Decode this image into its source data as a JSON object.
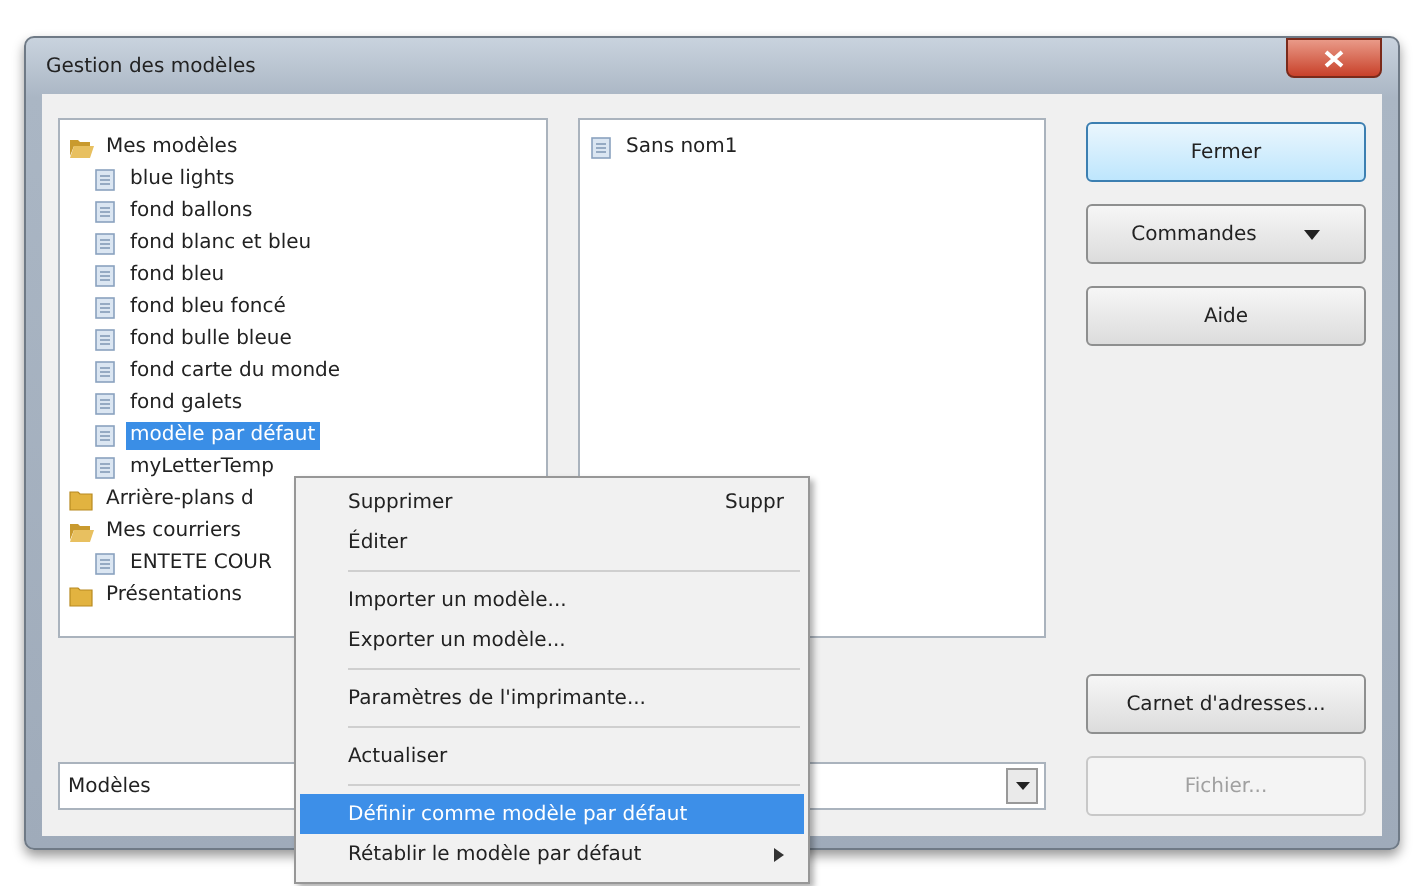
{
  "window": {
    "title": "Gestion des modèles"
  },
  "tree": [
    {
      "label": "Mes modèles",
      "kind": "folder",
      "expanded": true,
      "selected": false,
      "children": [
        {
          "label": "blue lights",
          "kind": "document",
          "selected": false
        },
        {
          "label": "fond ballons",
          "kind": "document",
          "selected": false
        },
        {
          "label": "fond blanc et bleu",
          "kind": "document",
          "selected": false
        },
        {
          "label": "fond bleu",
          "kind": "document",
          "selected": false
        },
        {
          "label": "fond bleu foncé",
          "kind": "document",
          "selected": false
        },
        {
          "label": "fond bulle bleue",
          "kind": "document",
          "selected": false
        },
        {
          "label": "fond carte du monde",
          "kind": "document",
          "selected": false
        },
        {
          "label": "fond galets",
          "kind": "document",
          "selected": false
        },
        {
          "label": "modèle par défaut",
          "kind": "document",
          "selected": true
        },
        {
          "label": "myLetterTemp",
          "kind": "document",
          "selected": false
        }
      ]
    },
    {
      "label": "Arrière-plans d",
      "kind": "folder",
      "expanded": false,
      "selected": false
    },
    {
      "label": "Mes courriers",
      "kind": "folder",
      "expanded": true,
      "selected": false,
      "children": [
        {
          "label": "ENTETE COUR",
          "kind": "document",
          "selected": false
        }
      ]
    },
    {
      "label": "Présentations",
      "kind": "folder",
      "expanded": false,
      "selected": false
    }
  ],
  "preview_list": [
    {
      "label": "Sans nom1",
      "kind": "document",
      "selected": false
    }
  ],
  "source_combo": {
    "value": "Modèles"
  },
  "buttons": [
    {
      "label": "Fermer",
      "default": true,
      "disabled": false,
      "dropdown": false
    },
    {
      "label": "Commandes",
      "default": false,
      "disabled": false,
      "dropdown": true
    },
    {
      "label": "Aide",
      "default": false,
      "disabled": false,
      "dropdown": false
    },
    {
      "label": "Carnet d'adresses...",
      "default": false,
      "disabled": false,
      "dropdown": false
    },
    {
      "label": "Fichier...",
      "default": false,
      "disabled": true,
      "dropdown": false
    }
  ],
  "context_menu": [
    {
      "kind": "item",
      "label": "Supprimer",
      "shortcut": "Suppr",
      "selected": false,
      "submenu": false
    },
    {
      "kind": "item",
      "label": "Éditer",
      "selected": false,
      "submenu": false
    },
    {
      "kind": "separator"
    },
    {
      "kind": "item",
      "label": "Importer un modèle...",
      "selected": false,
      "submenu": false
    },
    {
      "kind": "item",
      "label": "Exporter un modèle...",
      "selected": false,
      "submenu": false
    },
    {
      "kind": "separator"
    },
    {
      "kind": "item",
      "label": "Paramètres de l'imprimante...",
      "selected": false,
      "submenu": false
    },
    {
      "kind": "separator"
    },
    {
      "kind": "item",
      "label": "Actualiser",
      "selected": false,
      "submenu": false
    },
    {
      "kind": "separator"
    },
    {
      "kind": "item",
      "label": "Définir comme modèle par défaut",
      "selected": true,
      "submenu": false
    },
    {
      "kind": "item",
      "label": "Rétablir le modèle par défaut",
      "selected": false,
      "submenu": true
    }
  ]
}
